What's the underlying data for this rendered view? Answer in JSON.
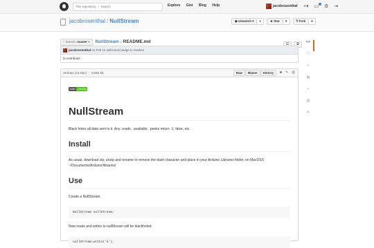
{
  "header": {
    "search_scope_label": "This repository",
    "search_placeholder": "Search",
    "nav": [
      "Explore",
      "Gist",
      "Blog",
      "Help"
    ],
    "username": "jacobrosenthal",
    "icons": [
      "plus-icon",
      "inbox-icon",
      "gear-icon",
      "signout-icon"
    ]
  },
  "repo": {
    "owner": "jacobrosenthal",
    "name": "NullStream",
    "unwatch_label": "Unwatch",
    "unwatch_count": "1",
    "star_label": "Star",
    "star_count": "0",
    "fork_label": "Fork",
    "fork_count": "0"
  },
  "file_nav": {
    "branch_label": "branch:",
    "branch": "master",
    "repo_link": "NullStream",
    "separator": "/",
    "file": "README.md"
  },
  "commit": {
    "author": "jacobrosenthal",
    "message": "on Feb 11 add travis badge to readme",
    "contributors_count": "1",
    "contributors_label": "contributor"
  },
  "file_header": {
    "lines": "19 lines (14 sloc)",
    "size": "0.552 kb",
    "raw": "Raw",
    "blame": "Blame",
    "history": "History"
  },
  "readme": {
    "badge_left": "build",
    "badge_right": "passing",
    "title": "NullStream",
    "intro": "Black holes all data sent to it. Any .reads, .available, .peeks return -1, false, etc.",
    "install_heading": "Install",
    "install_text": "As usual, download zip, unzip and rename to remove the dash character and place in your Arduino Libraries folder, on MacOSX ~/Documents/Arduino/libraries/",
    "use_heading": "Use",
    "use_text1": "Create a NullStream.",
    "code1": "NullStream nullStream;",
    "use_text2": "Now reads and writes to nullStream will be blackholed.",
    "code2": "nullStream.write('a');"
  },
  "colors": {
    "link": "#4183c4",
    "accent": "#d26911",
    "badge_pass": "#44cc11"
  }
}
